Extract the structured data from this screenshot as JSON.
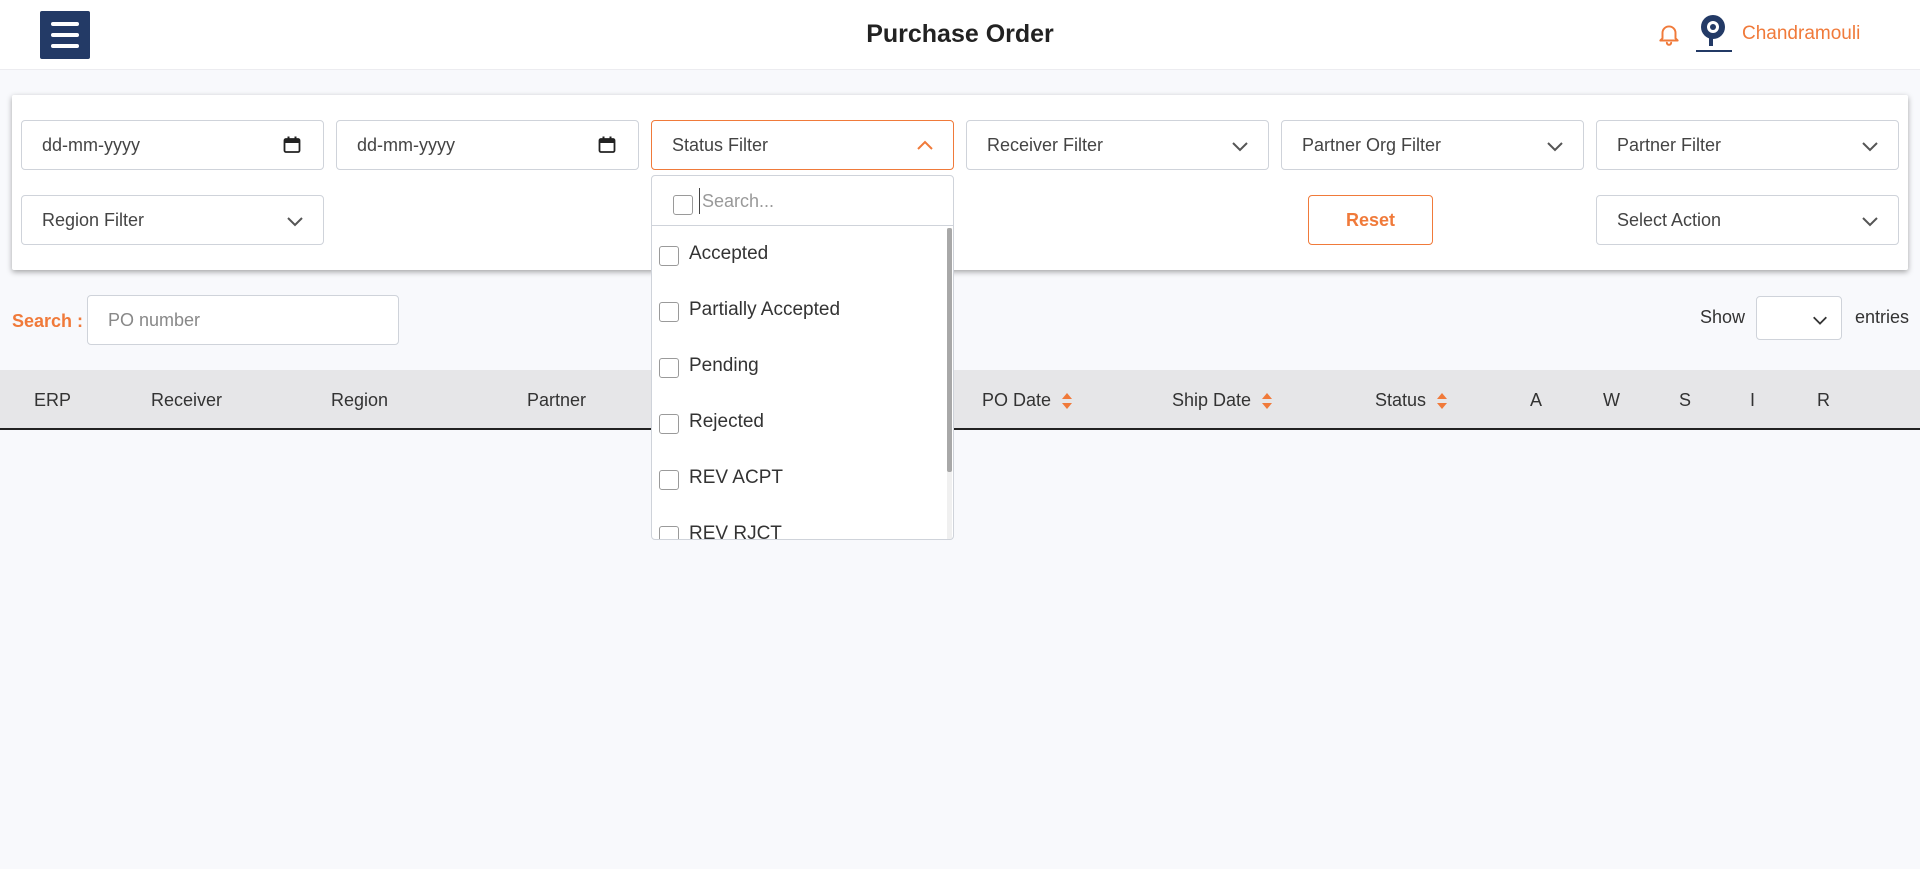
{
  "header": {
    "title": "Purchase Order",
    "username": "Chandramouli",
    "accent": "#f07a3a",
    "brand": "#233a66"
  },
  "filters": {
    "date_from_placeholder": "dd-mm-yyyy",
    "date_to_placeholder": "dd-mm-yyyy",
    "status": "Status Filter",
    "receiver": "Receiver Filter",
    "partner_org": "Partner Org Filter",
    "partner": "Partner Filter",
    "region": "Region Filter",
    "reset": "Reset",
    "action": "Select Action"
  },
  "status_dropdown": {
    "search_placeholder": "Search...",
    "options": [
      "Accepted",
      "Partially Accepted",
      "Pending",
      "Rejected",
      "REV ACPT",
      "REV RJCT"
    ]
  },
  "search": {
    "label": "Search :",
    "placeholder": "PO number"
  },
  "entries": {
    "show": "Show",
    "entries": "entries"
  },
  "table": {
    "columns": [
      "ERP",
      "Receiver",
      "Region",
      "Partner",
      "PO Date",
      "Ship Date",
      "Status",
      "A",
      "W",
      "S",
      "I",
      "R"
    ]
  }
}
